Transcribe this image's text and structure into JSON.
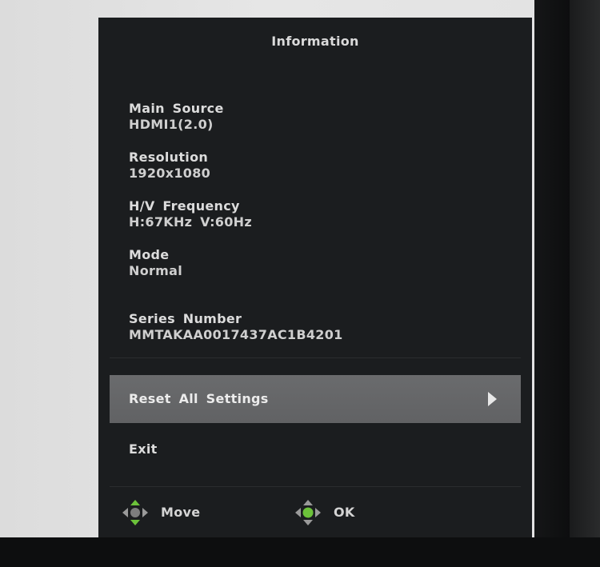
{
  "osd": {
    "title": "Information",
    "info": [
      {
        "label": "Main Source",
        "value": "HDMI1(2.0)"
      },
      {
        "label": "Resolution",
        "value": "1920x1080"
      },
      {
        "label": "H/V Frequency",
        "value": "H:67KHz V:60Hz"
      },
      {
        "label": "Mode",
        "value": "Normal"
      },
      {
        "label": "Series Number",
        "value": "MMTAKAA0017437AC1B4201"
      }
    ],
    "reset_label": "Reset All Settings",
    "exit_label": "Exit",
    "footer": {
      "move_label": "Move",
      "ok_label": "OK"
    }
  },
  "colors": {
    "osd_background": "#1b1d1f",
    "selected_row": "#666769",
    "dpad_green": "#6cc23a",
    "dpad_gray": "#9a9a9a"
  },
  "icons": {
    "reset_arrow": "triangle-right-icon",
    "move_hint": "dpad-move-icon",
    "ok_hint": "dpad-ok-icon"
  }
}
